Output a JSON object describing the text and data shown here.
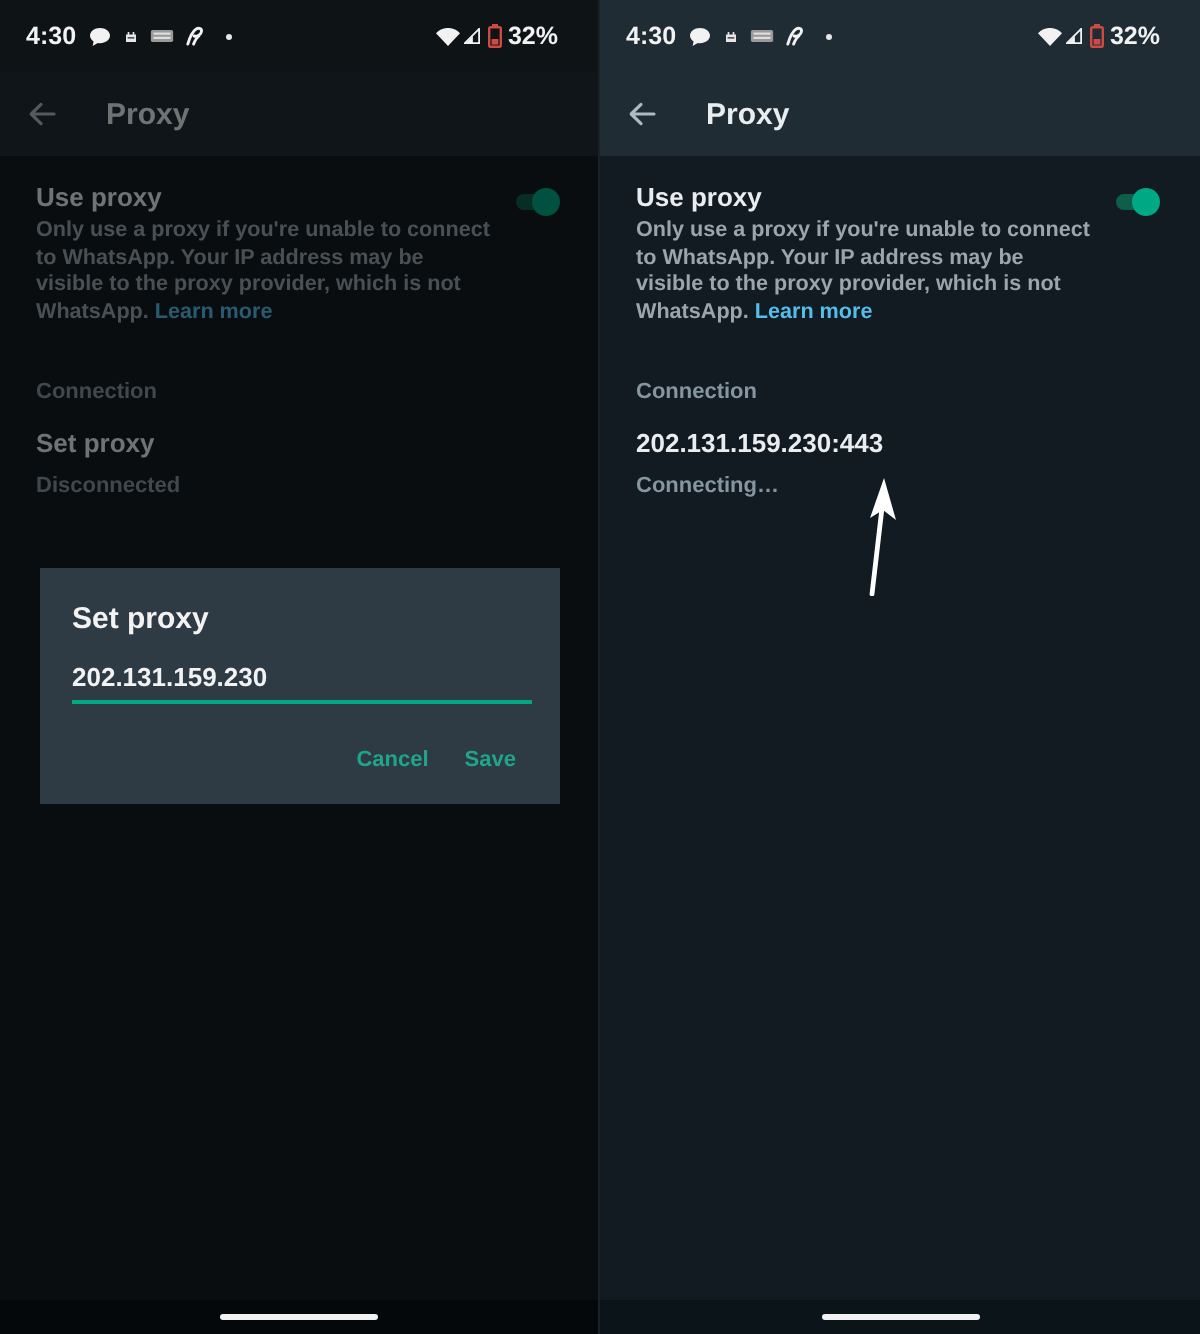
{
  "screens": [
    {
      "status_bar": {
        "time": "4:30",
        "battery": "32%"
      },
      "app_bar": {
        "title": "Proxy"
      },
      "use_proxy": {
        "title": "Use proxy",
        "description": "Only use a proxy if you're unable to connect to WhatsApp. Your IP address may be visible to the proxy provider, which is not WhatsApp.",
        "link": "Learn more",
        "on": true
      },
      "connection": {
        "header": "Connection",
        "title": "Set proxy",
        "status": "Disconnected"
      },
      "dialog": {
        "title": "Set proxy",
        "value": "202.131.159.230",
        "buttons": [
          "Cancel",
          "Save"
        ]
      },
      "annotation_arrow": false
    },
    {
      "status_bar": {
        "time": "4:30",
        "battery": "32%"
      },
      "app_bar": {
        "title": "Proxy"
      },
      "use_proxy": {
        "title": "Use proxy",
        "description": "Only use a proxy if you're unable to connect to WhatsApp. Your IP address may be visible to the proxy provider, which is not WhatsApp.",
        "link": "Learn more",
        "on": true
      },
      "connection": {
        "header": "Connection",
        "title": "202.131.159.230:443",
        "status": "Connecting…"
      },
      "annotation_arrow": true
    }
  ]
}
